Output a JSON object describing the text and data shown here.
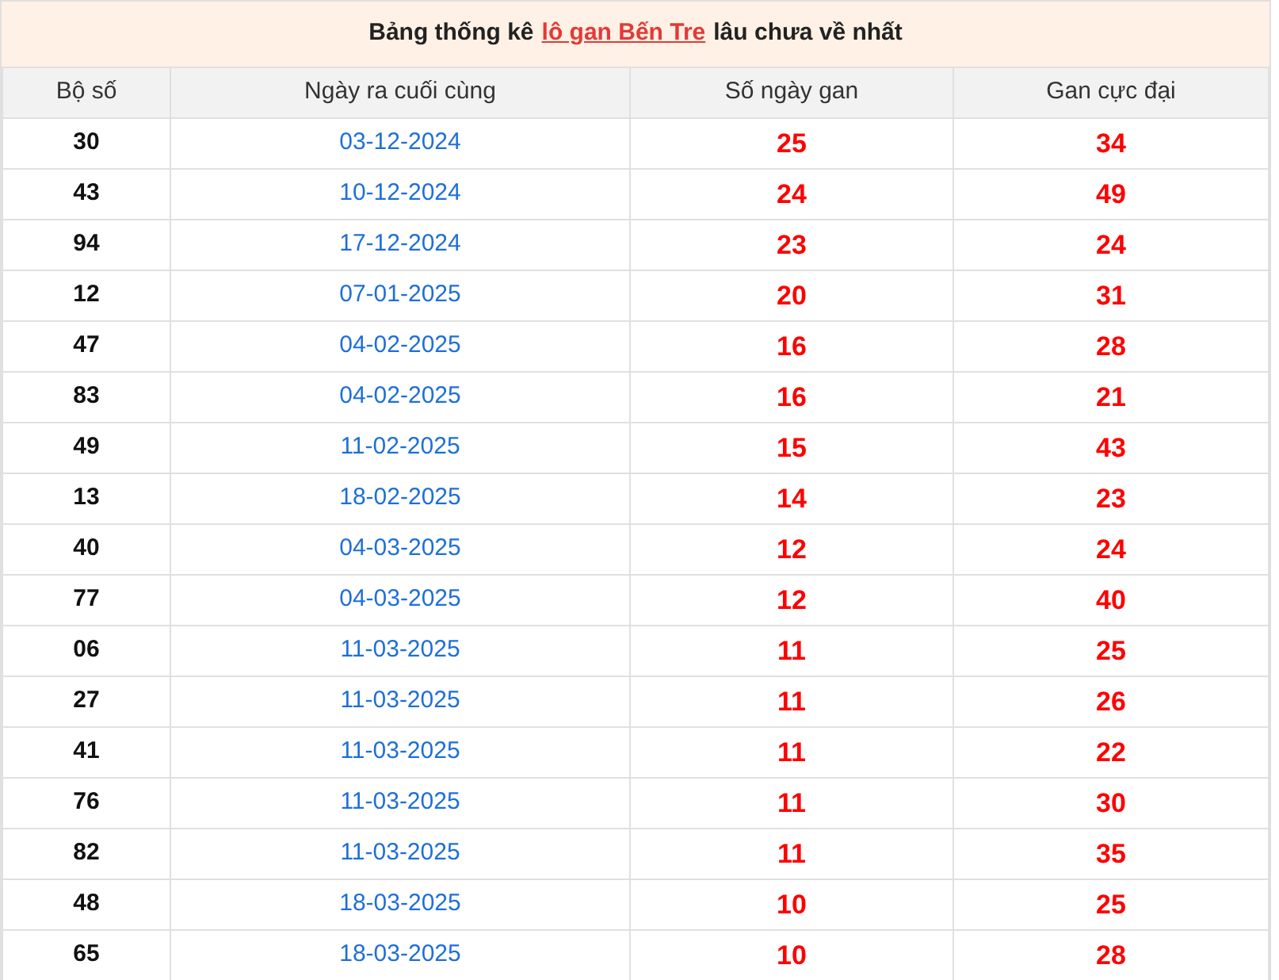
{
  "title": {
    "prefix": "Bảng thống kê",
    "link": "lô gan Bến Tre",
    "suffix": "lâu chưa về nhất"
  },
  "columns": [
    "Bộ số",
    "Ngày ra cuối cùng",
    "Số ngày gan",
    "Gan cực đại"
  ],
  "rows": [
    [
      "30",
      "03-12-2024",
      "25",
      "34"
    ],
    [
      "43",
      "10-12-2024",
      "24",
      "49"
    ],
    [
      "94",
      "17-12-2024",
      "23",
      "24"
    ],
    [
      "12",
      "07-01-2025",
      "20",
      "31"
    ],
    [
      "47",
      "04-02-2025",
      "16",
      "28"
    ],
    [
      "83",
      "04-02-2025",
      "16",
      "21"
    ],
    [
      "49",
      "11-02-2025",
      "15",
      "43"
    ],
    [
      "13",
      "18-02-2025",
      "14",
      "23"
    ],
    [
      "40",
      "04-03-2025",
      "12",
      "24"
    ],
    [
      "77",
      "04-03-2025",
      "12",
      "40"
    ],
    [
      "06",
      "11-03-2025",
      "11",
      "25"
    ],
    [
      "27",
      "11-03-2025",
      "11",
      "26"
    ],
    [
      "41",
      "11-03-2025",
      "11",
      "22"
    ],
    [
      "76",
      "11-03-2025",
      "11",
      "30"
    ],
    [
      "82",
      "11-03-2025",
      "11",
      "35"
    ],
    [
      "48",
      "18-03-2025",
      "10",
      "25"
    ],
    [
      "65",
      "18-03-2025",
      "10",
      "28"
    ]
  ]
}
